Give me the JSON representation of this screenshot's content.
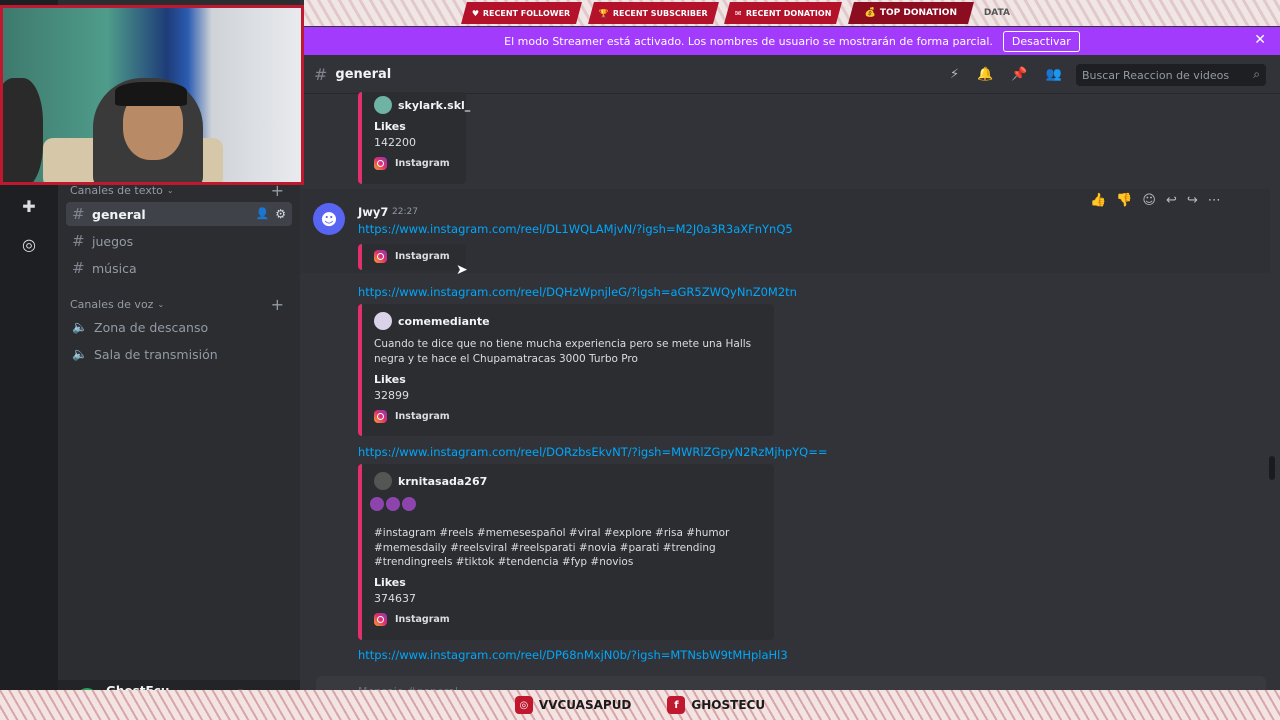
{
  "overlay": {
    "top_items": [
      "RECENT FOLLOWER",
      "RECENT SUBSCRIBER",
      "RECENT DONATION",
      "TOP DONATION"
    ],
    "top_tail": "DATA",
    "bottom_items": [
      "VVCUASAPUD",
      "GHOSTECU"
    ]
  },
  "notice": {
    "text": "El modo Streamer está activado. Los nombres de usuario se mostrarán de forma parcial.",
    "button": "Desactivar",
    "close": "✕"
  },
  "header": {
    "channel": "general",
    "search_placeholder": "Buscar Reaccion de videos"
  },
  "sidebar": {
    "text_category": "Canales de texto",
    "text_channels": [
      "general",
      "juegos",
      "música"
    ],
    "voice_category": "Canales de voz",
    "voice_channels": [
      "Zona de descanso",
      "Sala de transmisión"
    ]
  },
  "user": {
    "name": "GhostEcu"
  },
  "messages": {
    "first_embed": {
      "author": "skylark.skl_",
      "likes_label": "Likes",
      "likes": "142200",
      "footer": "Instagram"
    },
    "author": "Jwy7",
    "time": "22:27",
    "link1": "https://www.instagram.com/reel/DL1WQLAMjvN/?igsh=M2J0a3R3aXFnYnQ5",
    "embed1_footer": "Instagram",
    "link2": "https://www.instagram.com/reel/DQHzWpnjleG/?igsh=aGR5ZWQyNnZ0M2tn",
    "embed2": {
      "author": "comemediante",
      "desc": "Cuando te dice que no tiene mucha experiencia pero se mete una Halls negra y te hace el Chupamatracas 3000 Turbo Pro",
      "likes_label": "Likes",
      "likes": "32899",
      "footer": "Instagram"
    },
    "link3": "https://www.instagram.com/reel/DORzbsEkvNT/?igsh=MWRlZGpyN2RzMjhpYQ==",
    "embed3": {
      "author": "krnitasada267",
      "desc": "#instagram #reels #memesespañol #viral #explore #risa #humor #memesdaily #reelsviral #reelsparati #novia #parati #trending #trendingreels #tiktok #tendencia #fyp #novios",
      "likes_label": "Likes",
      "likes": "374637",
      "footer": "Instagram"
    },
    "link4": "https://www.instagram.com/reel/DP68nMxjN0b/?igsh=MTNsbW9tMHplaHl3"
  },
  "composer": {
    "placeholder": "Mensaje #general"
  }
}
